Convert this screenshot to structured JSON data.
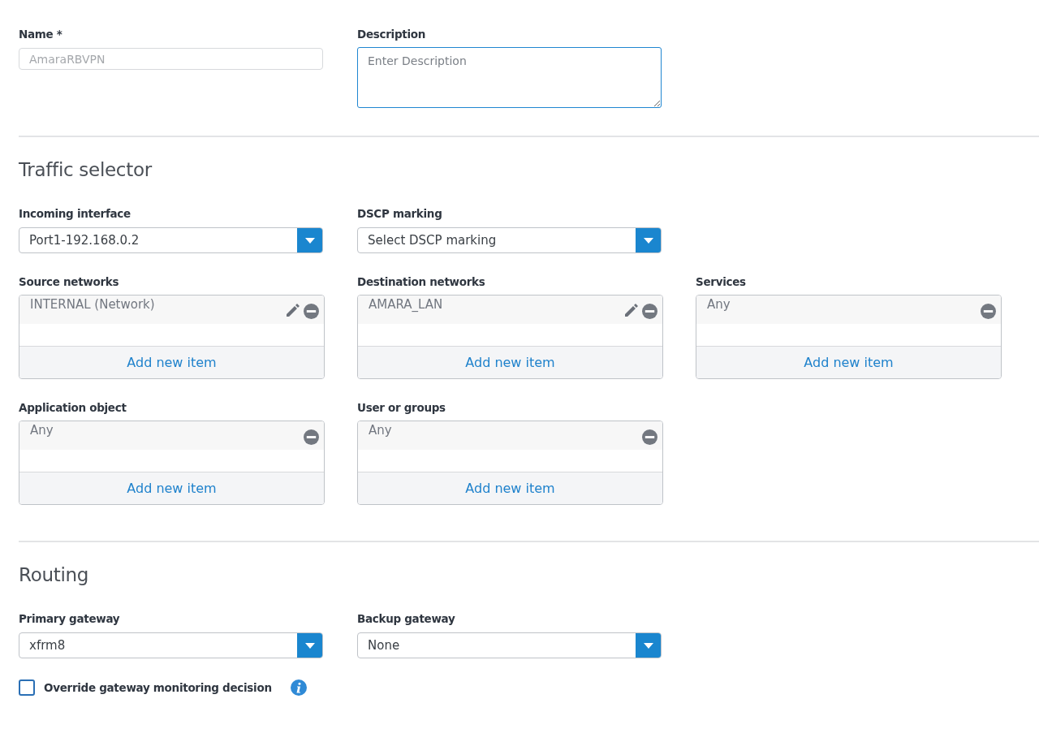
{
  "general": {
    "name": {
      "label": "Name *",
      "value": "AmaraRBVPN",
      "disabled": true
    },
    "description": {
      "label": "Description",
      "placeholder": "Enter Description",
      "focused": true
    }
  },
  "traffic_selector": {
    "title": "Traffic selector",
    "selects": [
      {
        "label": "Incoming interface",
        "value": "Port1-192.168.0.2"
      },
      {
        "label": "DSCP marking",
        "value": "Select DSCP marking"
      }
    ],
    "lists": [
      {
        "label": "Source networks",
        "items": [
          {
            "text": "INTERNAL (Network)",
            "editable": true
          }
        ],
        "add": "Add new item"
      },
      {
        "label": "Destination networks",
        "items": [
          {
            "text": "AMARA_LAN",
            "editable": true
          }
        ],
        "add": "Add new item"
      },
      {
        "label": "Services",
        "items": [
          {
            "text": "Any",
            "editable": false
          }
        ],
        "add": "Add new item"
      },
      {
        "label": "Application object",
        "items": [
          {
            "text": "Any",
            "editable": false
          }
        ],
        "add": "Add new item"
      },
      {
        "label": "User or groups",
        "items": [
          {
            "text": "Any",
            "editable": false
          }
        ],
        "add": "Add new item"
      }
    ]
  },
  "routing": {
    "title": "Routing",
    "selects": [
      {
        "label": "Primary gateway",
        "value": "xfrm8"
      },
      {
        "label": "Backup gateway",
        "value": "None"
      }
    ],
    "override": {
      "label": "Override gateway monitoring decision",
      "checked": false
    }
  }
}
